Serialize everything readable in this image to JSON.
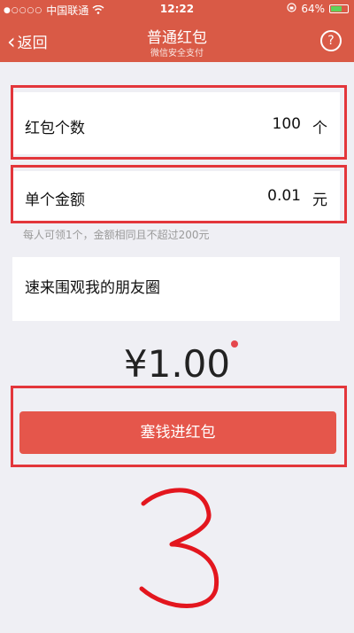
{
  "status_bar": {
    "carrier": "中国联通",
    "time": "12:22",
    "battery": "64%",
    "battery_level": 0.64
  },
  "nav": {
    "back_label": "返回",
    "title": "普通红包",
    "subtitle": "微信安全支付",
    "help_label": "?"
  },
  "form": {
    "count_label": "红包个数",
    "count_value": "100",
    "count_unit": "个",
    "amount_label": "单个金额",
    "amount_value": "0.01",
    "amount_unit": "元",
    "hint": "每人可领1个，金额相同且不超过200元",
    "message": "速来围观我的朋友圈"
  },
  "total": "¥1.00",
  "submit_label": "塞钱进红包",
  "annotation": "3",
  "colors": {
    "header": "#d95a46",
    "button": "#e5564b",
    "outline": "#e3363b"
  }
}
